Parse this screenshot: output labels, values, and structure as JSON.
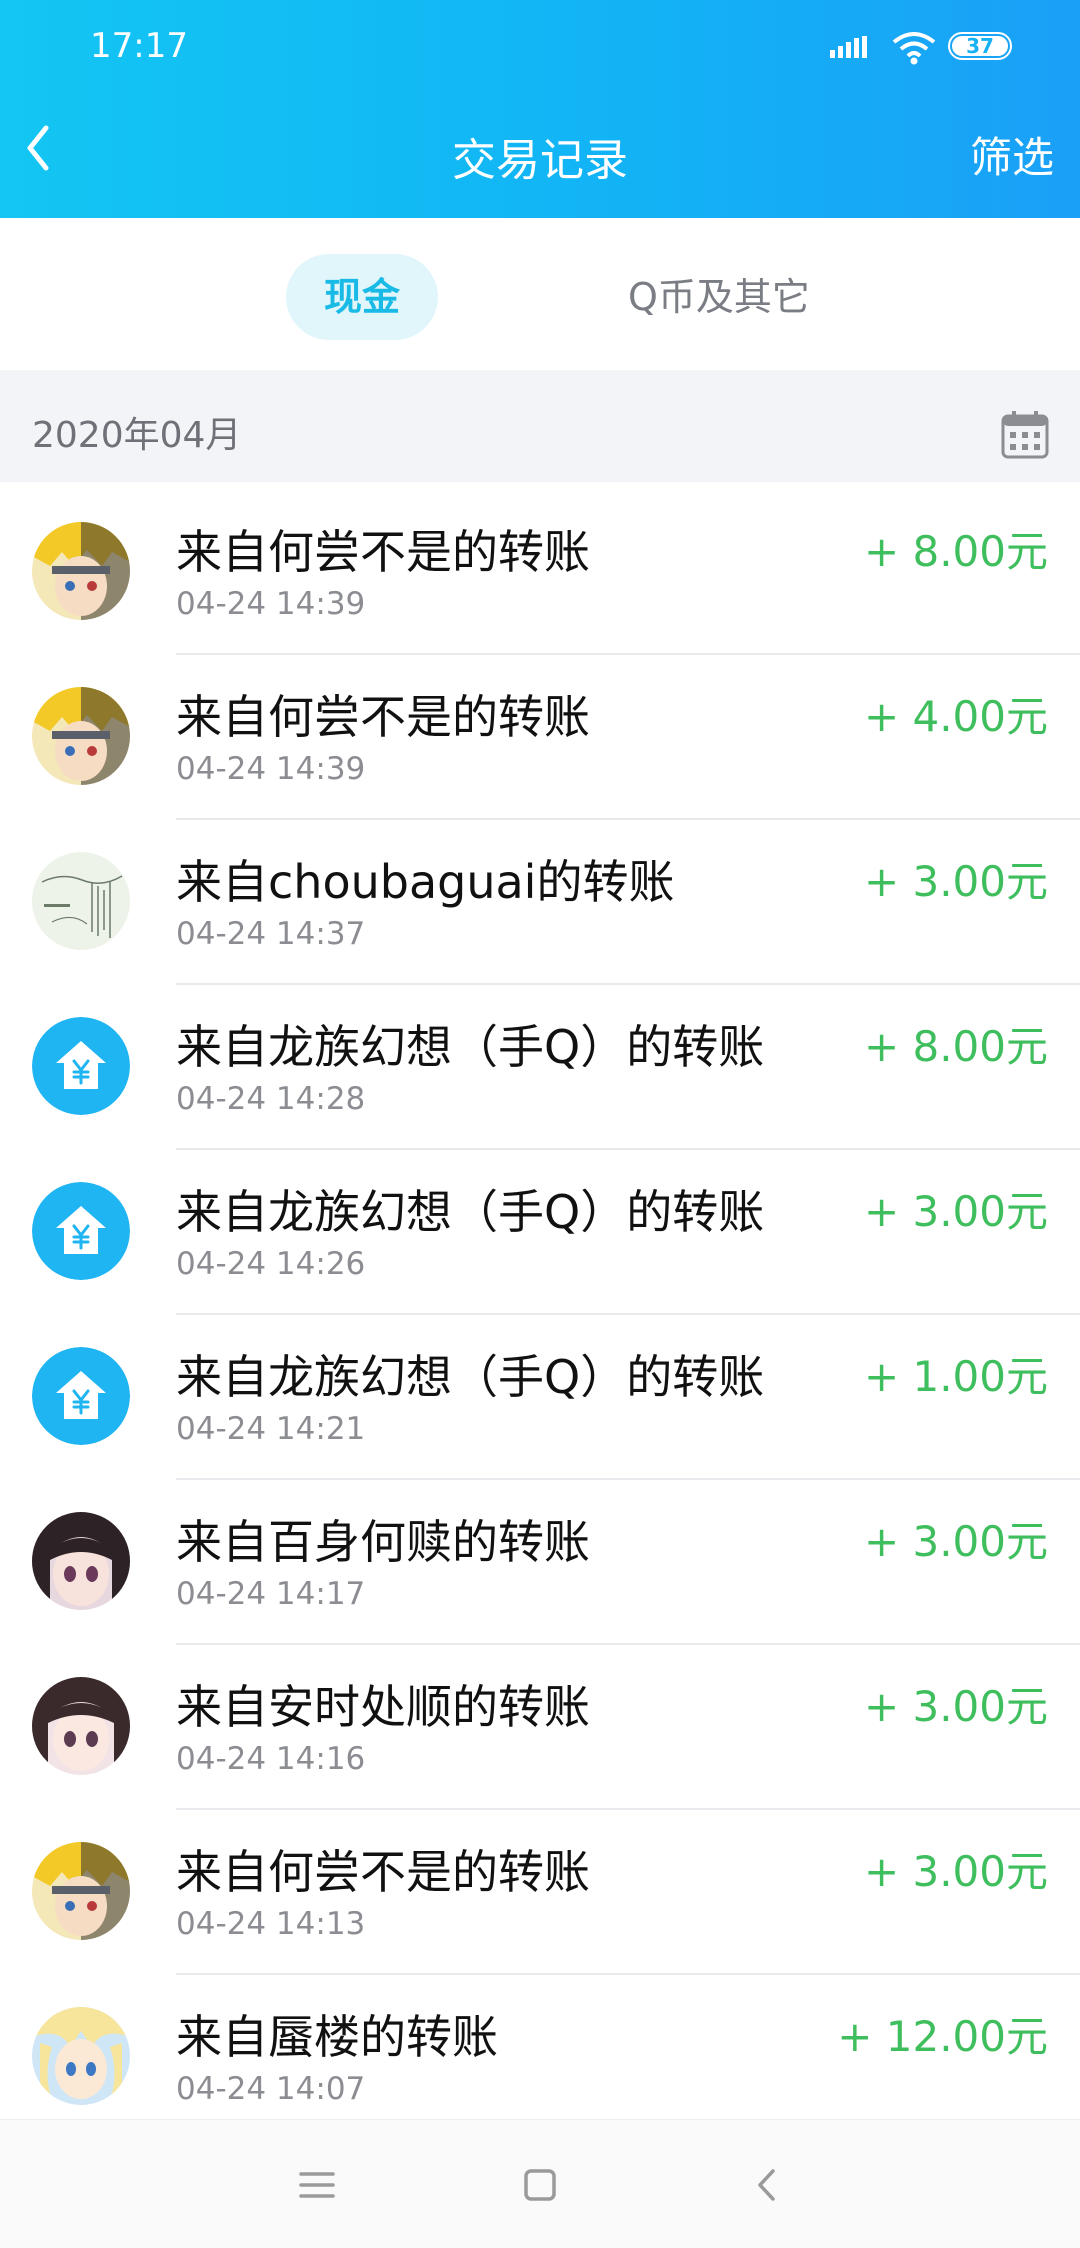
{
  "status_bar": {
    "time": "17:17",
    "battery_level": "37",
    "icons": [
      "signal-icon",
      "wifi-icon",
      "battery-icon"
    ]
  },
  "header": {
    "title": "交易记录",
    "filter_label": "筛选",
    "back_icon": "chevron-left-icon",
    "gradient_colors": [
      "#13c6f3",
      "#1aa0f7"
    ]
  },
  "tabs": [
    {
      "label": "现金",
      "active": true
    },
    {
      "label": "Q币及其它",
      "active": false
    }
  ],
  "month": {
    "label": "2020年04月",
    "icon": "calendar-icon"
  },
  "transactions": [
    {
      "title": "来自何尝不是的转账",
      "time": "04-24 14:39",
      "amount": "+ 8.00元",
      "avatar": "anime-avatar-blond"
    },
    {
      "title": "来自何尝不是的转账",
      "time": "04-24 14:39",
      "amount": "+ 4.00元",
      "avatar": "anime-avatar-blond"
    },
    {
      "title": "来自choubaguai的转账",
      "time": "04-24 14:37",
      "amount": "+ 3.00元",
      "avatar": "sketch-avatar"
    },
    {
      "title": "来自龙族幻想（手Q）的转账",
      "time": "04-24 14:28",
      "amount": "+ 8.00元",
      "avatar": "yuan-house-icon"
    },
    {
      "title": "来自龙族幻想（手Q）的转账",
      "time": "04-24 14:26",
      "amount": "+ 3.00元",
      "avatar": "yuan-house-icon"
    },
    {
      "title": "来自龙族幻想（手Q）的转账",
      "time": "04-24 14:21",
      "amount": "+ 1.00元",
      "avatar": "yuan-house-icon"
    },
    {
      "title": "来自百身何赎的转账",
      "time": "04-24 14:17",
      "amount": "+ 3.00元",
      "avatar": "anime-avatar-darkhair"
    },
    {
      "title": "来自安时处顺的转账",
      "time": "04-24 14:16",
      "amount": "+ 3.00元",
      "avatar": "anime-avatar-darkhair"
    },
    {
      "title": "来自何尝不是的转账",
      "time": "04-24 14:13",
      "amount": "+ 3.00元",
      "avatar": "anime-avatar-blond"
    },
    {
      "title": "来自蜃楼的转账",
      "time": "04-24 14:07",
      "amount": "+ 12.00元",
      "avatar": "anime-avatar-lightblond"
    }
  ],
  "colors": {
    "accent": "#19bbe6",
    "income": "#3fbe5d",
    "yuan_icon_bg": "#1fb4f2"
  },
  "navbar": {
    "buttons": [
      "menu-icon",
      "home-icon",
      "back-icon"
    ]
  }
}
